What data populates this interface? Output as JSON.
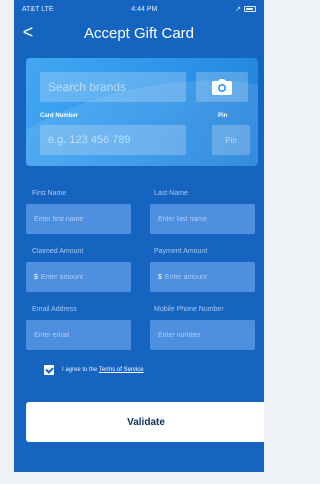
{
  "status_bar": {
    "carrier": "AT&T LTE",
    "time": "4:44 PM"
  },
  "header": {
    "title": "Accept Gift Card",
    "back": "<"
  },
  "card": {
    "search_placeholder": "Search brands",
    "card_number_label": "Card Number",
    "card_number_placeholder": "e.g. 123 456 789",
    "pin_label": "Pin",
    "pin_placeholder": "Pin"
  },
  "form": {
    "first_name_label": "First Name",
    "first_name_placeholder": "Enter first name",
    "last_name_label": "Last Name",
    "last_name_placeholder": "Enter last name",
    "claimed_amount_label": "Claimed Amount",
    "claimed_amount_placeholder": "Enter amount",
    "payment_amount_label": "Payment Amount",
    "payment_amount_placeholder": "Enter amount",
    "email_label": "Email Address",
    "email_placeholder": "Enter email",
    "phone_label": "Mobile Phone Number",
    "phone_placeholder": "Enter number",
    "currency_symbol": "$"
  },
  "agreement": {
    "prefix": "I agree to the ",
    "link": "Terms of Service"
  },
  "actions": {
    "validate_label": "Validate"
  },
  "colors": {
    "brand": "#1565c0",
    "card_accent": "#2f95ea",
    "field": "#4e8fe0"
  }
}
